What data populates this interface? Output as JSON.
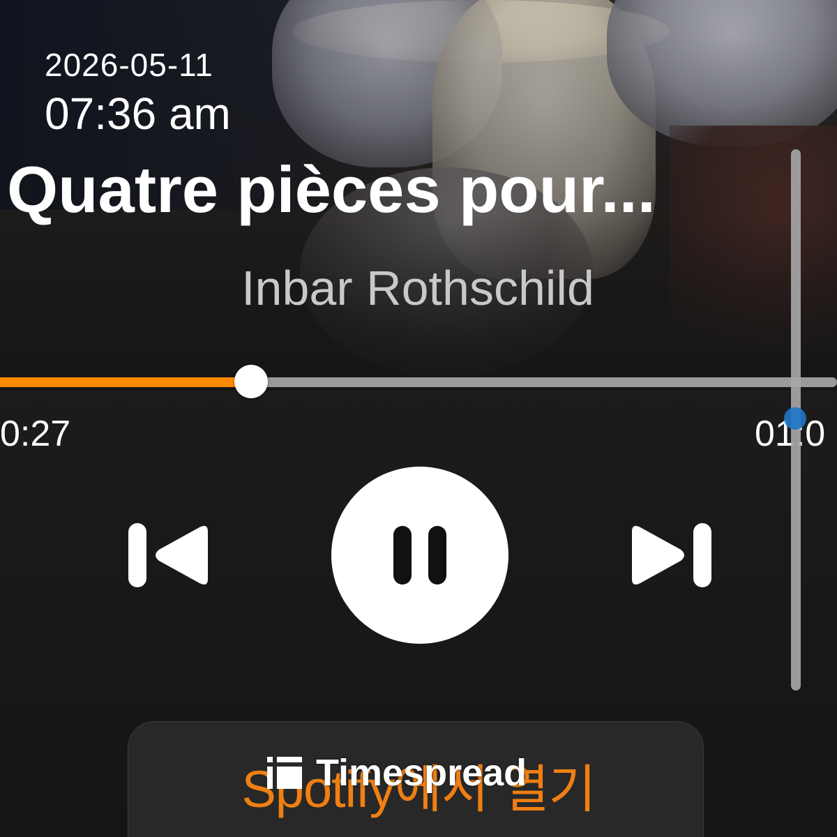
{
  "status": {
    "date": "2026-05-11",
    "time": "07:36 am"
  },
  "track": {
    "title": "Quatre pièces pour...",
    "artist": "Inbar Rothschild"
  },
  "playback": {
    "elapsed": "0:27",
    "total": "01:0",
    "progress_fraction": 0.3,
    "state": "playing"
  },
  "controls": {
    "previous_icon": "skip-previous-icon",
    "pause_icon": "pause-icon",
    "next_icon": "skip-next-icon"
  },
  "actions": {
    "open_label": "Spotify에서 열기"
  },
  "watermark": {
    "icon": "timespread-logo-icon",
    "text": "Timespread"
  },
  "colors": {
    "accent": "#ff8a00",
    "open_label": "#f07f13",
    "background": "#151515"
  }
}
